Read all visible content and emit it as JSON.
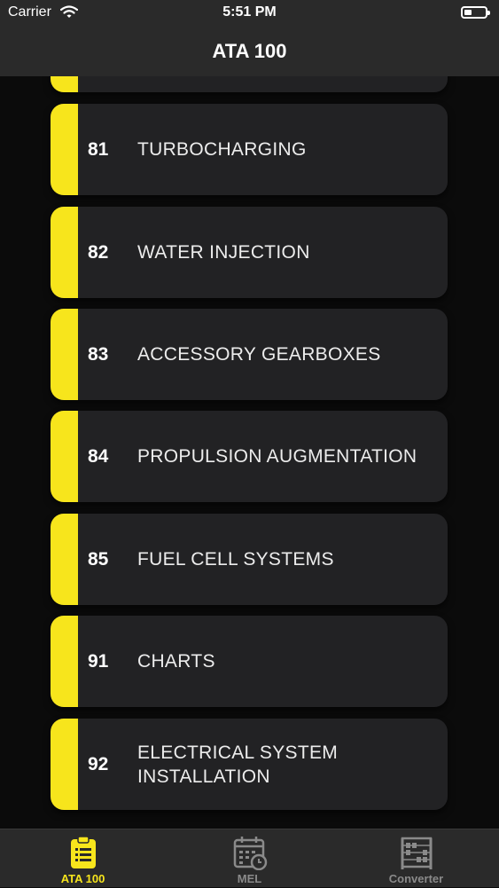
{
  "status_bar": {
    "carrier": "Carrier",
    "time": "5:51 PM"
  },
  "nav": {
    "title": "ATA 100"
  },
  "colors": {
    "accent": "#f7e51c",
    "card_bg": "#222224",
    "bar_bg": "#2a2a2a",
    "inactive_tab": "#8a8a8a"
  },
  "chapters": [
    {
      "code": "81",
      "title": "TURBOCHARGING"
    },
    {
      "code": "82",
      "title": "WATER INJECTION"
    },
    {
      "code": "83",
      "title": "ACCESSORY GEARBOXES"
    },
    {
      "code": "84",
      "title": "PROPULSION AUGMENTATION"
    },
    {
      "code": "85",
      "title": "FUEL CELL SYSTEMS"
    },
    {
      "code": "91",
      "title": "CHARTS"
    },
    {
      "code": "92",
      "title": "ELECTRICAL SYSTEM INSTALLATION"
    }
  ],
  "tabs": [
    {
      "label": "ATA 100",
      "icon": "clipboard-list-icon",
      "active": true
    },
    {
      "label": "MEL",
      "icon": "calendar-clock-icon",
      "active": false
    },
    {
      "label": "Converter",
      "icon": "abacus-icon",
      "active": false
    }
  ]
}
